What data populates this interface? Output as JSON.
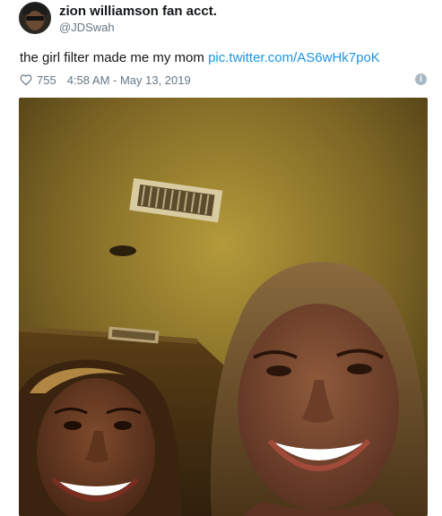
{
  "tweet": {
    "author": {
      "display_name": "zion williamson fan acct.",
      "handle": "@JDSwah",
      "avatar_icon": "profile-avatar"
    },
    "text": "the girl filter made me my mom",
    "link": "pic.twitter.com/AS6wHk7poK",
    "likes": "755",
    "timestamp": "4:58 AM - May 13, 2019",
    "icons": {
      "like": "heart-icon",
      "info": "info-icon"
    },
    "colors": {
      "link": "#1b95e0",
      "secondary_text": "#657786",
      "primary_text": "#14171a"
    },
    "media": {
      "type": "photo",
      "description_icon": "selfie-photo"
    }
  }
}
